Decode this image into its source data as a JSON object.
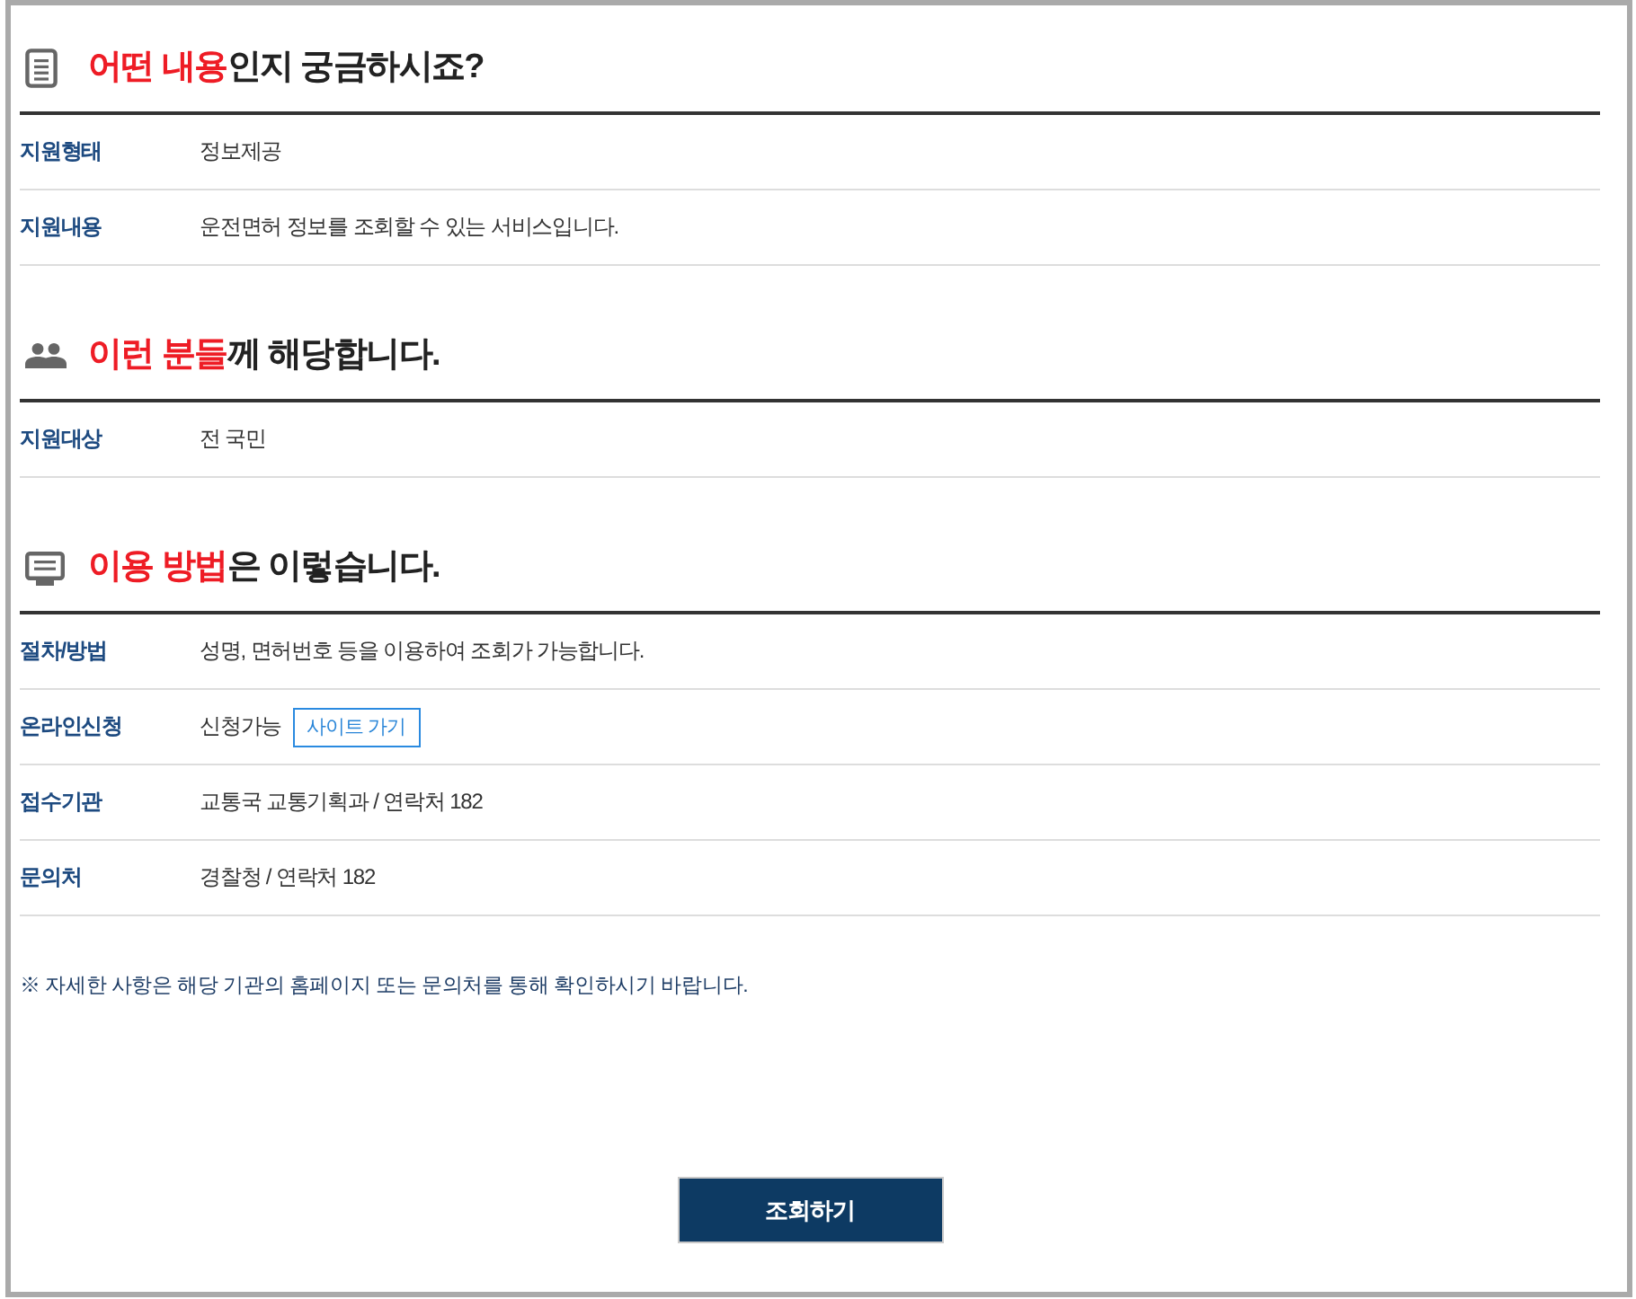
{
  "sections": [
    {
      "title_highlight": "어떤 내용",
      "title_rest": "인지 궁금하시죠?",
      "rows": [
        {
          "label": "지원형태",
          "value": "정보제공"
        },
        {
          "label": "지원내용",
          "value": "운전면허 정보를 조회할 수 있는 서비스입니다."
        }
      ]
    },
    {
      "title_highlight": "이런 분들",
      "title_rest": "께 해당합니다.",
      "rows": [
        {
          "label": "지원대상",
          "value": "전 국민"
        }
      ]
    },
    {
      "title_highlight": "이용 방법",
      "title_rest": "은 이렇습니다.",
      "rows": [
        {
          "label": "절차/방법",
          "value": "성명, 면허번호 등을 이용하여 조회가 가능합니다."
        },
        {
          "label": "온라인신청",
          "value": "신청가능",
          "link": "사이트 가기"
        },
        {
          "label": "접수기관",
          "value": "교통국 교통기획과 / 연락처 182"
        },
        {
          "label": "문의처",
          "value": "경찰청 / 연락처 182"
        }
      ]
    }
  ],
  "notice": "※ 자세한 사항은 해당 기관의 홈페이지 또는 문의처를 통해 확인하시기 바랍니다.",
  "button": "조회하기"
}
